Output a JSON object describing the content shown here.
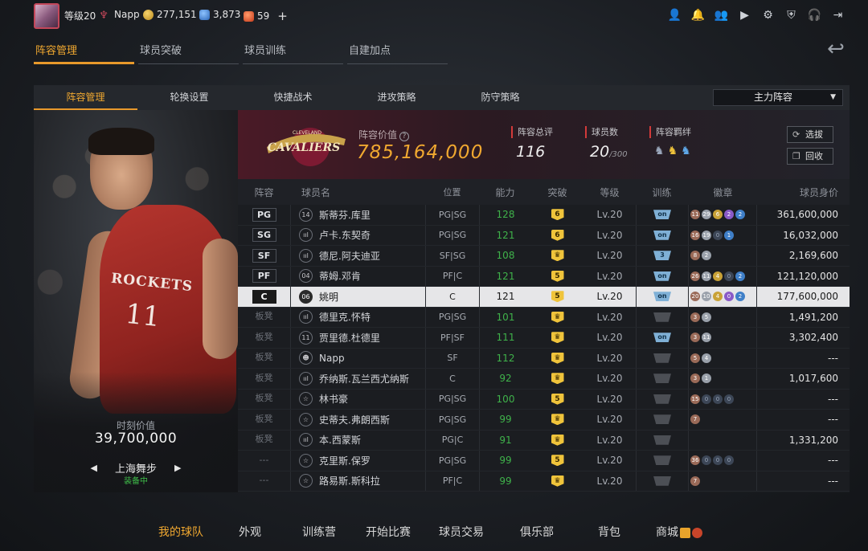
{
  "topbar": {
    "level": "等级20",
    "username": "Napp",
    "gold": "277,151",
    "diamonds": "3,873",
    "tickets": "59",
    "plus": "+"
  },
  "main_tabs": [
    "阵容管理",
    "球员突破",
    "球员训练",
    "自建加点"
  ],
  "sub_tabs": [
    "阵容管理",
    "轮换设置",
    "快捷战术",
    "进攻策略",
    "防守策略"
  ],
  "lineup_select": "主力阵容",
  "player_card": {
    "jersey_text": "ROCKETS",
    "jersey_number": "11",
    "moment_label": "时刻价值",
    "moment_value": "39,700,000",
    "skill_name": "上海舞步",
    "skill_status": "装备中"
  },
  "team": {
    "logo_text": "CAVALIERS",
    "logo_subtext": "CLEVELAND",
    "value_label": "阵容价值",
    "value": "785,164,000",
    "rating_label": "阵容总评",
    "rating": "116",
    "count_label": "球员数",
    "count": "20",
    "count_max": "/300",
    "bond_label": "阵容羁绊",
    "btn_select": "选拔",
    "btn_recycle": "回收"
  },
  "table": {
    "headers": [
      "阵容",
      "球员名",
      "位置",
      "能力",
      "突破",
      "等级",
      "训练",
      "徽章",
      "球员身价"
    ],
    "rows": [
      {
        "pos": "PG",
        "bench": false,
        "num": "14",
        "name": "斯蒂芬.库里",
        "slot": "PG|SG",
        "ability": "128",
        "brk": "6",
        "level": "Lv.20",
        "trn": "on",
        "badges": [
          [
            "11",
            "bronze"
          ],
          [
            "29",
            "silver"
          ],
          [
            "6",
            "gold"
          ],
          [
            "2",
            "purple"
          ],
          [
            "2",
            "blue"
          ]
        ],
        "value": "361,600,000"
      },
      {
        "pos": "SG",
        "bench": false,
        "num": "ııl",
        "name": "卢卡.东契奇",
        "slot": "PG|SG",
        "ability": "121",
        "brk": "6",
        "level": "Lv.20",
        "trn": "on",
        "badges": [
          [
            "16",
            "bronze"
          ],
          [
            "19",
            "silver"
          ],
          [
            "0",
            "dark"
          ],
          [
            "1",
            "blue"
          ]
        ],
        "value": "16,032,000"
      },
      {
        "pos": "SF",
        "bench": false,
        "num": "ııl",
        "name": "德尼.阿夫迪亚",
        "slot": "SF|SG",
        "ability": "108",
        "brk": "♛",
        "level": "Lv.20",
        "trn": "3",
        "badges": [
          [
            "8",
            "bronze"
          ],
          [
            "2",
            "silver"
          ]
        ],
        "value": "2,169,600"
      },
      {
        "pos": "PF",
        "bench": false,
        "num": "04",
        "name": "蒂姆.邓肯",
        "slot": "PF|C",
        "ability": "121",
        "brk": "5",
        "level": "Lv.20",
        "trn": "on",
        "badges": [
          [
            "26",
            "bronze"
          ],
          [
            "11",
            "silver"
          ],
          [
            "4",
            "gold"
          ],
          [
            "0",
            "dark"
          ],
          [
            "2",
            "blue"
          ]
        ],
        "value": "121,120,000"
      },
      {
        "pos": "C",
        "bench": false,
        "num": "06",
        "name": "姚明",
        "slot": "C",
        "ability": "121",
        "brk": "5",
        "level": "Lv.20",
        "trn": "on",
        "badges": [
          [
            "20",
            "bronze"
          ],
          [
            "10",
            "silver"
          ],
          [
            "4",
            "gold"
          ],
          [
            "0",
            "purple"
          ],
          [
            "2",
            "blue"
          ]
        ],
        "value": "177,600,000",
        "selected": true
      },
      {
        "pos": "板凳",
        "bench": true,
        "num": "ııl",
        "name": "德里克.怀特",
        "slot": "PG|SG",
        "ability": "101",
        "brk": "♛",
        "level": "Lv.20",
        "trn": "off",
        "badges": [
          [
            "3",
            "bronze"
          ],
          [
            "5",
            "silver"
          ]
        ],
        "value": "1,491,200"
      },
      {
        "pos": "板凳",
        "bench": true,
        "num": "11",
        "name": "贾里德.杜德里",
        "slot": "PF|SF",
        "ability": "111",
        "brk": "♛",
        "level": "Lv.20",
        "trn": "on",
        "badges": [
          [
            "3",
            "bronze"
          ],
          [
            "11",
            "silver"
          ]
        ],
        "value": "3,302,400"
      },
      {
        "pos": "板凳",
        "bench": true,
        "num": "☻",
        "name": "Napp",
        "slot": "SF",
        "ability": "112",
        "brk": "♛",
        "level": "Lv.20",
        "trn": "off",
        "badges": [
          [
            "5",
            "bronze"
          ],
          [
            "4",
            "silver"
          ]
        ],
        "value": "---"
      },
      {
        "pos": "板凳",
        "bench": true,
        "num": "ııl",
        "name": "乔纳斯.瓦兰西尤纳斯",
        "slot": "C",
        "ability": "92",
        "brk": "♛",
        "level": "Lv.20",
        "trn": "off",
        "badges": [
          [
            "3",
            "bronze"
          ],
          [
            "1",
            "silver"
          ]
        ],
        "value": "1,017,600"
      },
      {
        "pos": "板凳",
        "bench": true,
        "num": "☆",
        "name": "林书豪",
        "slot": "PG|SG",
        "ability": "100",
        "brk": "5",
        "level": "Lv.20",
        "trn": "off",
        "badges": [
          [
            "15",
            "bronze"
          ],
          [
            "0",
            "dark"
          ],
          [
            "0",
            "dark"
          ],
          [
            "0",
            "dark"
          ]
        ],
        "value": "---"
      },
      {
        "pos": "板凳",
        "bench": true,
        "num": "☆",
        "name": "史蒂夫.弗朗西斯",
        "slot": "PG|SG",
        "ability": "99",
        "brk": "♛",
        "level": "Lv.20",
        "trn": "off",
        "badges": [
          [
            "7",
            "bronze"
          ]
        ],
        "value": "---"
      },
      {
        "pos": "板凳",
        "bench": true,
        "num": "ııl",
        "name": "本.西蒙斯",
        "slot": "PG|C",
        "ability": "91",
        "brk": "♛",
        "level": "Lv.20",
        "trn": "off",
        "badges": [],
        "value": "1,331,200"
      },
      {
        "pos": "---",
        "bench": true,
        "num": "☆",
        "name": "克里斯.保罗",
        "slot": "PG|SG",
        "ability": "99",
        "brk": "5",
        "level": "Lv.20",
        "trn": "off",
        "badges": [
          [
            "36",
            "bronze"
          ],
          [
            "0",
            "dark"
          ],
          [
            "0",
            "dark"
          ],
          [
            "0",
            "dark"
          ]
        ],
        "value": "---"
      },
      {
        "pos": "---",
        "bench": true,
        "num": "☆",
        "name": "路易斯.斯科拉",
        "slot": "PF|C",
        "ability": "99",
        "brk": "♛",
        "level": "Lv.20",
        "trn": "off",
        "badges": [
          [
            "7",
            "bronze"
          ]
        ],
        "value": "---"
      }
    ]
  },
  "bottom_nav": [
    "我的球队",
    "外观",
    "训练营",
    "开始比赛",
    "球员交易",
    "俱乐部",
    "背包",
    "商城"
  ],
  "colors": {
    "accent": "#e8992b",
    "ability_green": "#3fb24a",
    "selected_row": "#e6e6e8"
  }
}
